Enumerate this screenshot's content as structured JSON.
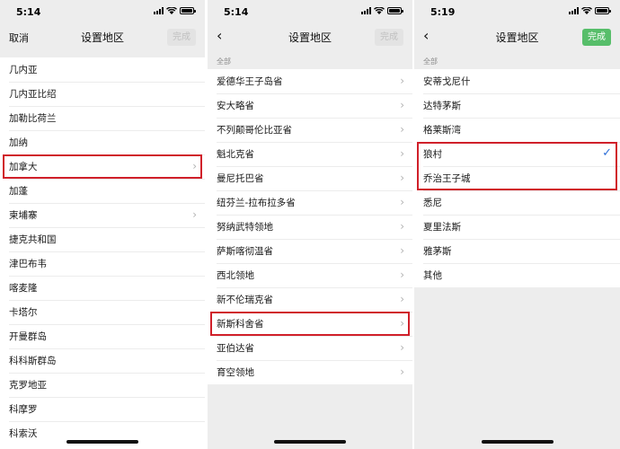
{
  "panels": [
    {
      "time": "5:14",
      "title": "设置地区",
      "left_label": "取消",
      "done_label": "完成",
      "rows": [
        "几内亚",
        "几内亚比绍",
        "加勒比荷兰",
        "加纳",
        "加拿大",
        "加蓬",
        "柬埔寨",
        "捷克共和国",
        "津巴布韦",
        "喀麦隆",
        "卡塔尔",
        "开曼群岛",
        "科科斯群岛",
        "克罗地亚",
        "科摩罗",
        "科索沃"
      ],
      "chevron_rows": [
        "加拿大",
        "柬埔寨"
      ],
      "highlighted_row": "加拿大"
    },
    {
      "time": "5:14",
      "title": "设置地区",
      "done_label": "完成",
      "section": "全部",
      "rows": [
        "爱德华王子岛省",
        "安大略省",
        "不列颠哥伦比亚省",
        "魁北克省",
        "曼尼托巴省",
        "纽芬兰-拉布拉多省",
        "努纳武特领地",
        "萨斯喀彻温省",
        "西北领地",
        "新不伦瑞克省",
        "新斯科舍省",
        "亚伯达省",
        "育空领地"
      ],
      "highlighted_row": "新斯科舍省"
    },
    {
      "time": "5:19",
      "title": "设置地区",
      "done_label": "完成",
      "section": "全部",
      "rows": [
        "安蒂戈尼什",
        "达特茅斯",
        "格莱斯湾",
        "狼村",
        "乔治王子城",
        "悉尼",
        "夏里法斯",
        "雅茅斯",
        "其他"
      ],
      "selected_row": "狼村",
      "highlighted_rows": [
        "狼村",
        "乔治王子城"
      ]
    }
  ],
  "colors": {
    "highlight": "#d0202a",
    "done_active": "#57be6a",
    "check": "#2f6fd8"
  },
  "icons": {
    "back": "chevron-left-icon",
    "row": "chevron-right-icon",
    "selected": "checkmark-icon"
  }
}
